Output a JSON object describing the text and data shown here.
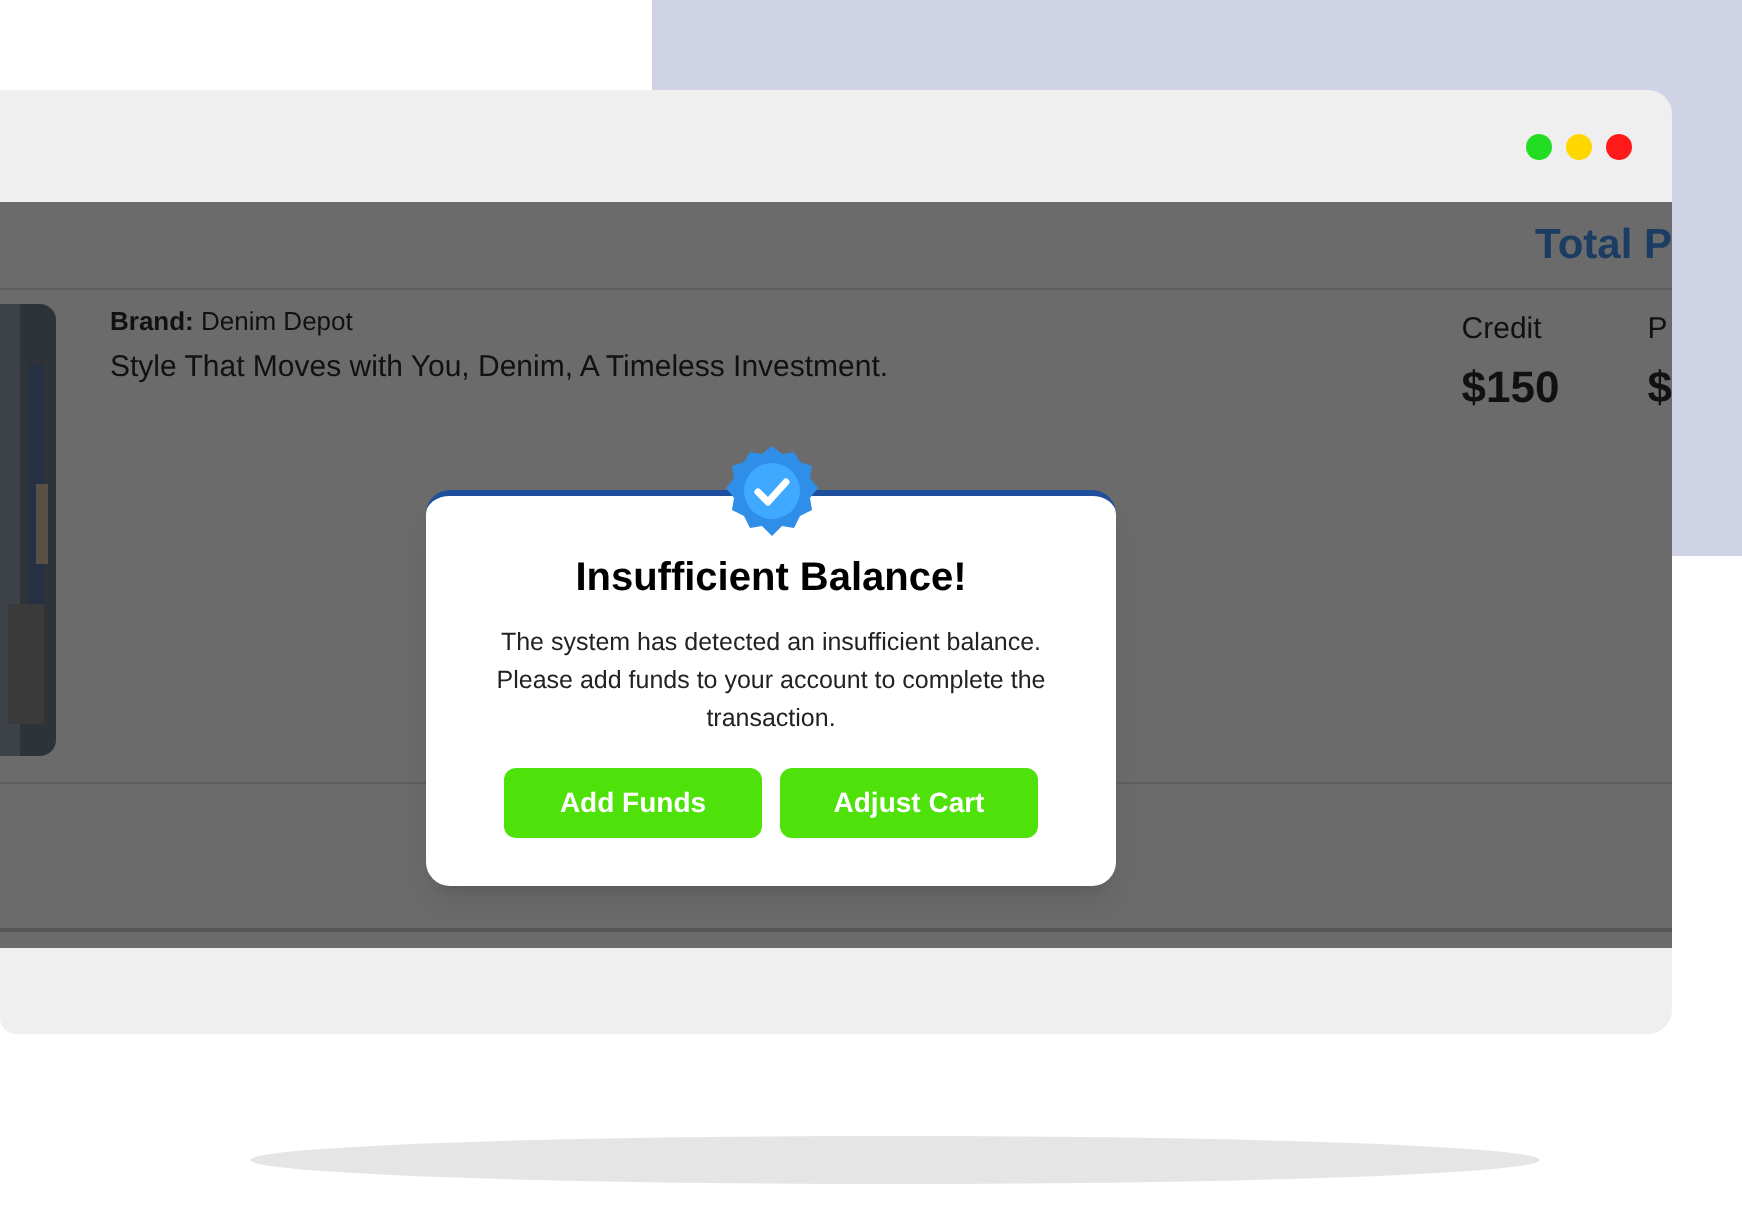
{
  "window": {
    "controls": [
      {
        "color": "#22dd22"
      },
      {
        "color": "#ffd700"
      },
      {
        "color": "#ff1a1a"
      }
    ]
  },
  "header": {
    "title": "Total P"
  },
  "product": {
    "brand_label": "Brand:",
    "brand": "Denim Depot",
    "tagline": "Style That Moves with You, Denim, A Timeless Investment.",
    "columns": [
      {
        "label": "Credit",
        "value": "$150"
      },
      {
        "label": "P",
        "value": "$"
      }
    ]
  },
  "dialog": {
    "title": "Insufficient Balance!",
    "message": "The system has detected an insufficient balance. Please add funds to your account to complete the transaction.",
    "buttons": [
      "Add Funds",
      "Adjust Cart"
    ]
  }
}
